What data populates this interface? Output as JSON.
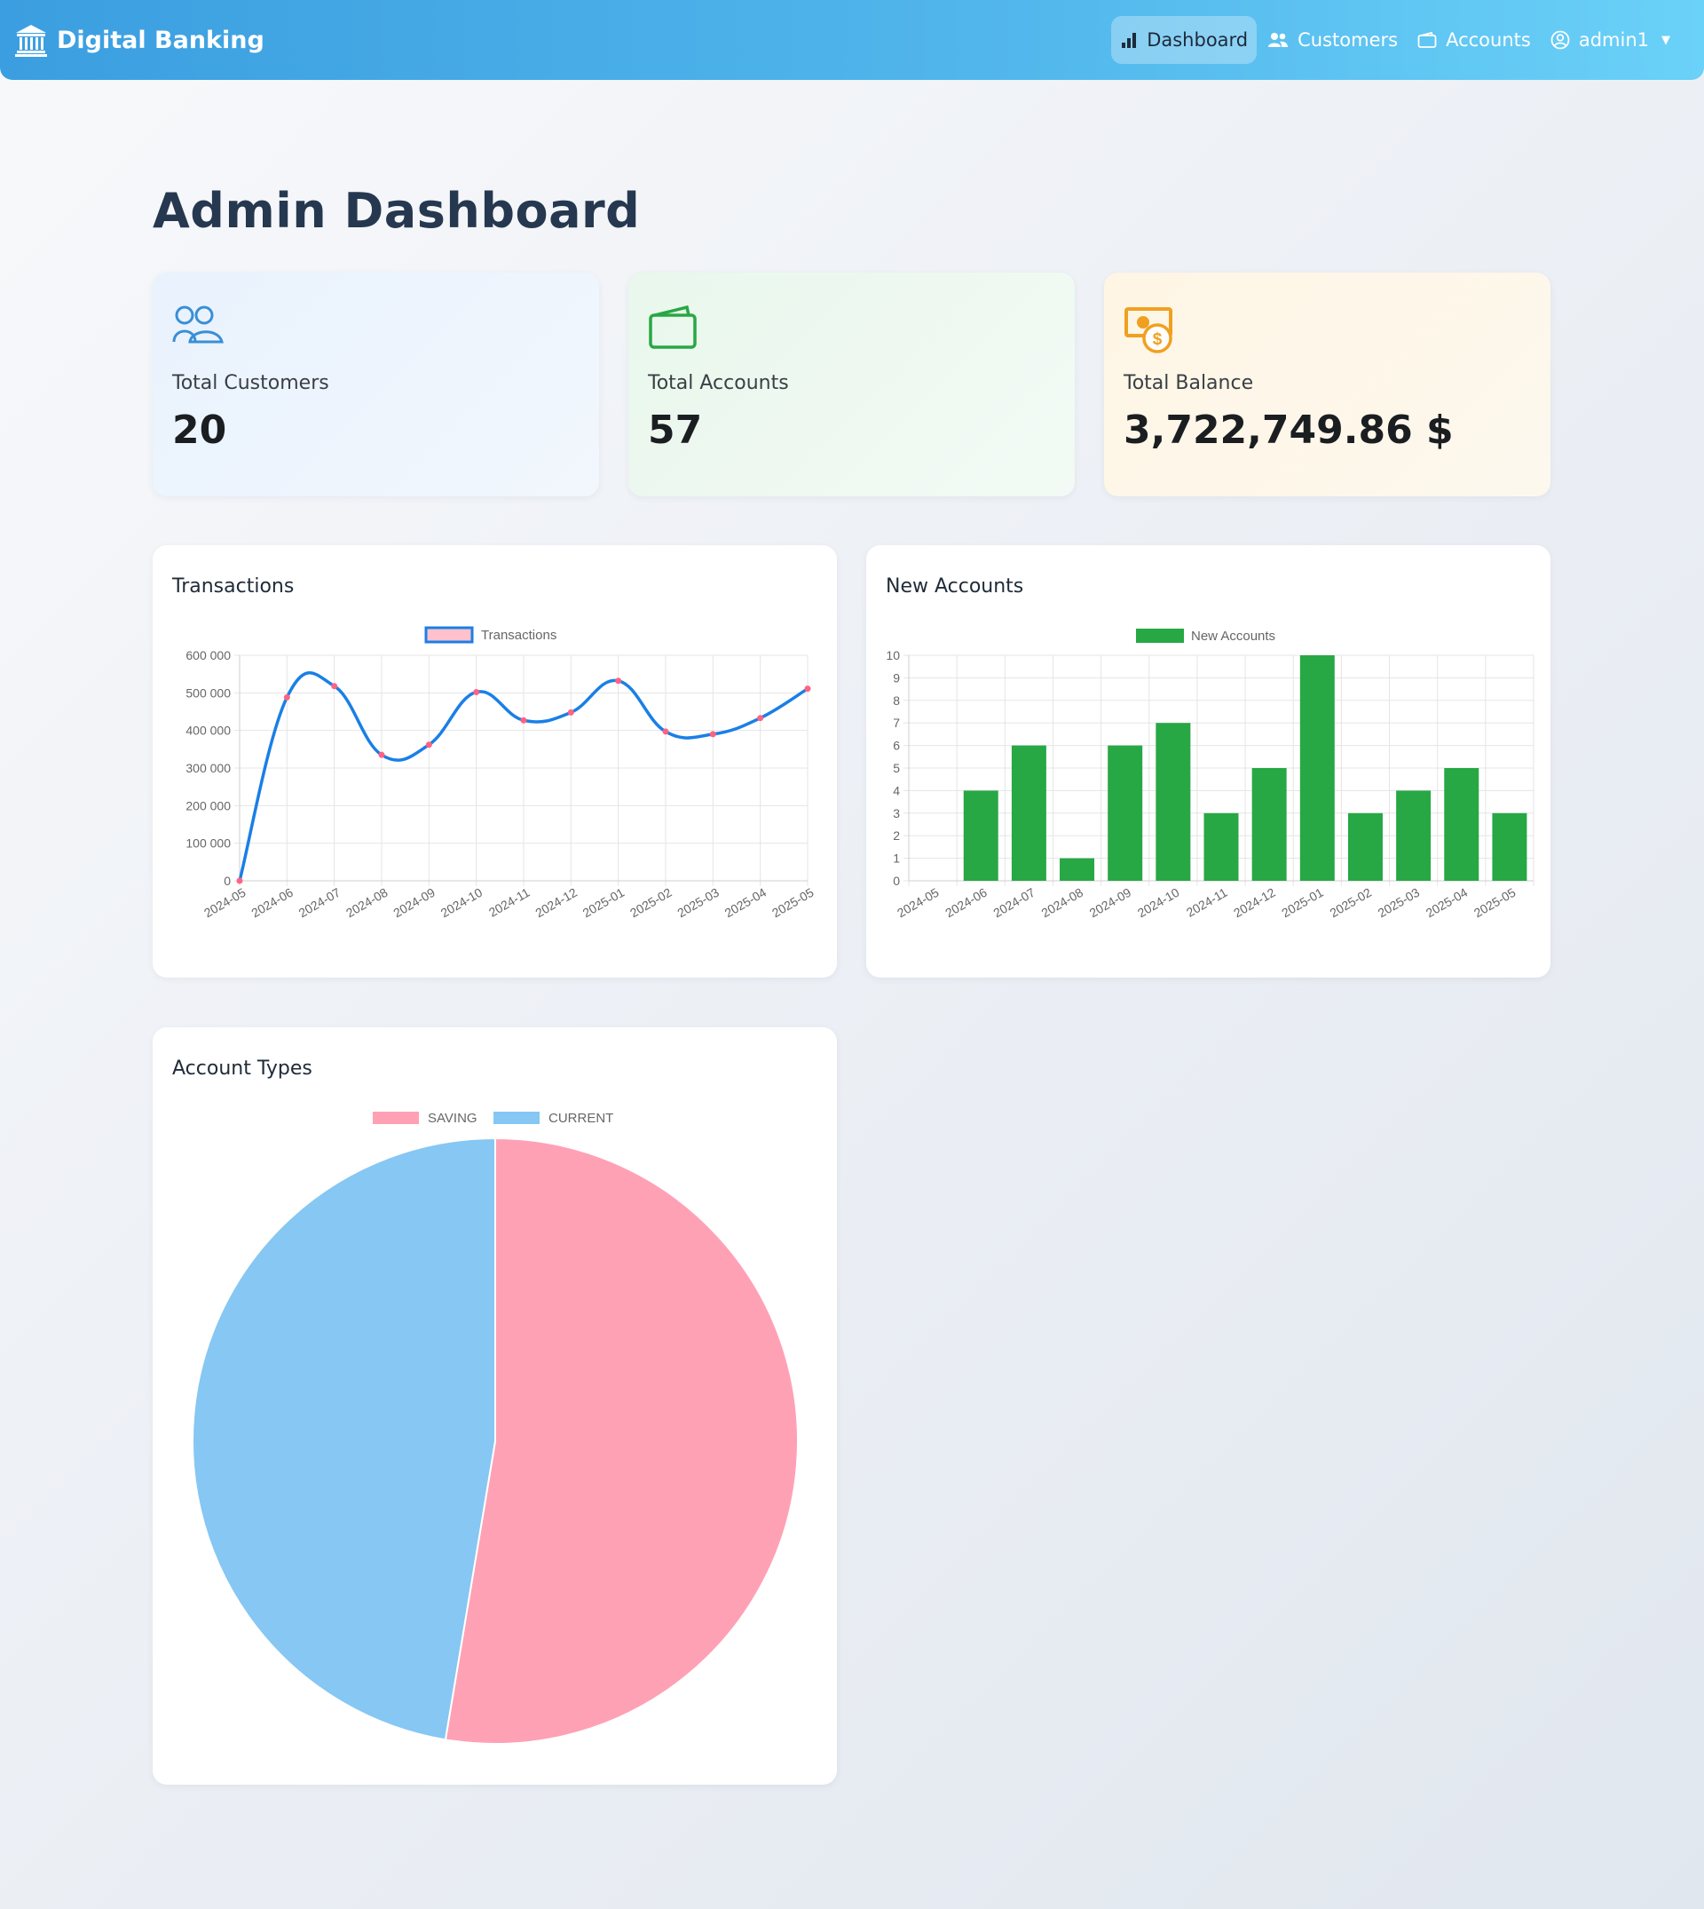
{
  "nav": {
    "brand": "Digital Banking",
    "items": [
      {
        "label": "Dashboard",
        "icon": "bar-chart-icon",
        "active": true
      },
      {
        "label": "Customers",
        "icon": "people-icon"
      },
      {
        "label": "Accounts",
        "icon": "wallet-icon"
      },
      {
        "label": "admin1",
        "icon": "user-circle-icon"
      }
    ]
  },
  "page": {
    "title": "Admin Dashboard"
  },
  "stats": [
    {
      "label": "Total Customers",
      "value": "20",
      "icon": "people-icon",
      "color": "#3a8fd6"
    },
    {
      "label": "Total Accounts",
      "value": "57",
      "icon": "wallet-icon",
      "color": "#28a745"
    },
    {
      "label": "Total Balance",
      "value": "3,722,749.86 $",
      "icon": "cash-coin-icon",
      "color": "#f0a020"
    }
  ],
  "cards": {
    "transactions_title": "Transactions",
    "new_accounts_title": "New Accounts",
    "account_types_title": "Account Types"
  },
  "chart_data": [
    {
      "type": "line",
      "title": "",
      "legend": [
        "Transactions"
      ],
      "legend_position": "top",
      "categories": [
        "2024-05",
        "2024-06",
        "2024-07",
        "2024-08",
        "2024-09",
        "2024-10",
        "2024-11",
        "2024-12",
        "2025-01",
        "2025-02",
        "2025-03",
        "2025-04",
        "2025-05"
      ],
      "series": [
        {
          "name": "Transactions",
          "values": [
            0,
            488000,
            518000,
            335000,
            362000,
            502000,
            427000,
            448000,
            532000,
            397000,
            390000,
            433000,
            511000
          ]
        }
      ],
      "ylim": [
        0,
        600000
      ],
      "yticks": [
        "0",
        "100 000",
        "200 000",
        "300 000",
        "400 000",
        "500 000",
        "600 000"
      ],
      "grid": true,
      "colors": {
        "line": "#1a7fe6",
        "point": "#ff6384"
      }
    },
    {
      "type": "bar",
      "title": "",
      "legend": [
        "New Accounts"
      ],
      "legend_position": "top",
      "categories": [
        "2024-05",
        "2024-06",
        "2024-07",
        "2024-08",
        "2024-09",
        "2024-10",
        "2024-11",
        "2024-12",
        "2025-01",
        "2025-02",
        "2025-03",
        "2025-04",
        "2025-05"
      ],
      "series": [
        {
          "name": "New Accounts",
          "values": [
            0,
            4,
            6,
            1,
            6,
            7,
            3,
            5,
            10,
            3,
            4,
            5,
            3
          ]
        }
      ],
      "ylim": [
        0,
        10
      ],
      "yticks": [
        "0",
        "1",
        "2",
        "3",
        "4",
        "5",
        "6",
        "7",
        "8",
        "9",
        "10"
      ],
      "grid": true,
      "colors": {
        "bar": "#28a745"
      }
    },
    {
      "type": "pie",
      "title": "",
      "legend": [
        "SAVING",
        "CURRENT"
      ],
      "legend_position": "top",
      "categories": [
        "SAVING",
        "CURRENT"
      ],
      "values": [
        30,
        27
      ],
      "colors": {
        "SAVING": "#ffa1b5",
        "CURRENT": "#86c7f3"
      }
    }
  ]
}
